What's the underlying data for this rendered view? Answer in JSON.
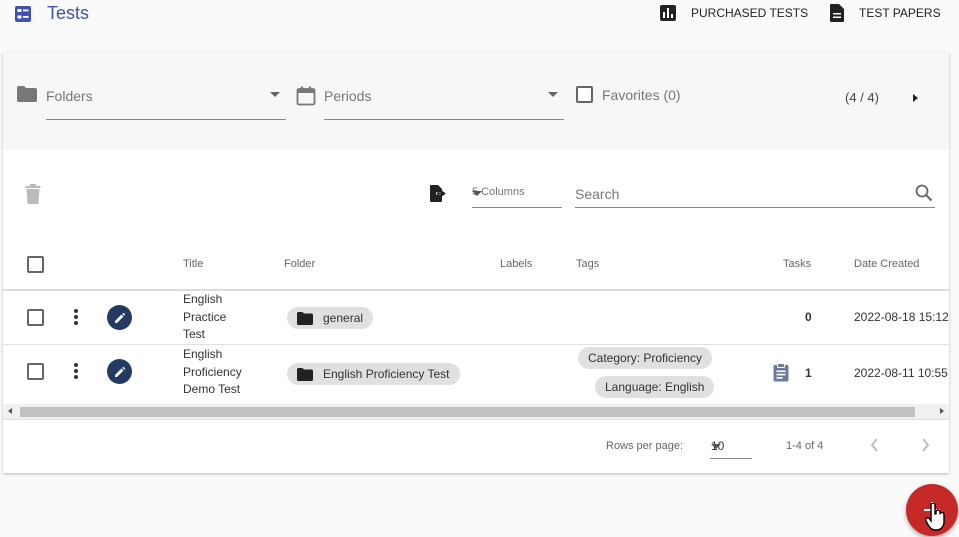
{
  "app": {
    "title": "Tests"
  },
  "header": {
    "purchased_label": "PURCHASED TESTS",
    "papers_label": "TEST PAPERS"
  },
  "filters": {
    "folders_label": "Folders",
    "periods_label": "Periods",
    "favorites_label": "Favorites (0)",
    "page_count": "(4 / 4)"
  },
  "toolbar": {
    "columns_label": "5 Columns",
    "search_placeholder": "Search"
  },
  "table": {
    "headers": {
      "title": "Title",
      "folder": "Folder",
      "labels": "Labels",
      "tags": "Tags",
      "tasks": "Tasks",
      "date_created": "Date Created"
    },
    "rows": [
      {
        "title_lines": [
          "English",
          "Practice",
          "Test"
        ],
        "folder": "general",
        "tags": [],
        "tasks": "0",
        "date": "2022-08-18 15:12"
      },
      {
        "title_lines": [
          "English",
          "Proficiency",
          "Demo Test"
        ],
        "folder": "English Proficiency Test",
        "tags": [
          "Category: Proficiency",
          "Language: English"
        ],
        "tasks": "1",
        "date": "2022-08-11 10:55"
      }
    ]
  },
  "footer": {
    "rows_per_page_label": "Rows per page:",
    "rows_per_page_value": "10",
    "range": "1-4 of 4"
  },
  "colors": {
    "brand": "#3f51b5",
    "edit_button": "#243a63",
    "fab": "#c62828",
    "chip": "#e0e0e0"
  },
  "icons": {
    "app": "dashboard-list-icon",
    "purchased": "bar-chart-icon",
    "papers": "document-icon",
    "fab": "plus-icon"
  }
}
